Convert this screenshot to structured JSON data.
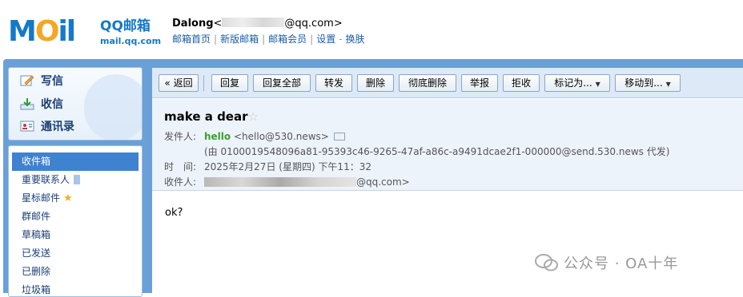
{
  "header": {
    "logo_big": "M",
    "logo_o": "O",
    "logo_il": "il",
    "brand": "QQ邮箱",
    "url": "mail.qq.com",
    "user_name": "Dalong",
    "user_lt": "<",
    "user_email_domain": "@qq.com>",
    "links": [
      "邮箱首页",
      "新版邮箱",
      "邮箱会员",
      "设置",
      "换肤"
    ]
  },
  "sidebar": {
    "quick": [
      {
        "label": "写信",
        "icon": "pencil-icon"
      },
      {
        "label": "收信",
        "icon": "inbox-download-icon"
      },
      {
        "label": "通讯录",
        "icon": "contact-card-icon"
      }
    ],
    "folders": [
      {
        "label": "收件箱",
        "active": true
      },
      {
        "label": "重要联系人",
        "icon": "bookmark-icon"
      },
      {
        "label": "星标邮件",
        "icon": "star-icon"
      },
      {
        "label": "群邮件"
      },
      {
        "label": "草稿箱"
      },
      {
        "label": "已发送"
      },
      {
        "label": "已删除"
      },
      {
        "label": "垃圾箱"
      }
    ]
  },
  "toolbar": {
    "back": "« 返回",
    "reply": "回复",
    "reply_all": "回复全部",
    "forward": "转发",
    "delete": "删除",
    "delete_permanent": "彻底删除",
    "report": "举报",
    "reject": "拒收",
    "mark_as": "标记为...",
    "move_to": "移动到..."
  },
  "mail": {
    "subject": "make a dear",
    "star": "☆",
    "from_label": "发件人:",
    "from_name": "hello",
    "from_addr": "<hello@530.news>",
    "via": "(由 0100019548096a81-95393c46-9265-47af-a86c-a9491dcae2f1-000000@send.530.news 代发)",
    "time_label": "时　间:",
    "time_value": "2025年2月27日 (星期四) 下午11：32",
    "to_label": "收件人:",
    "to_domain": "@qq.com>",
    "body": "ok?"
  },
  "watermark": "公众号 · OA十年",
  "colors": {
    "brand_blue": "#1479c8",
    "logo_orange": "#f5a623",
    "frame_blue": "#6aa0d8",
    "active_folder": "#3f82cf",
    "sender_green": "#3aa02a",
    "star_yellow": "#f2b21e"
  }
}
